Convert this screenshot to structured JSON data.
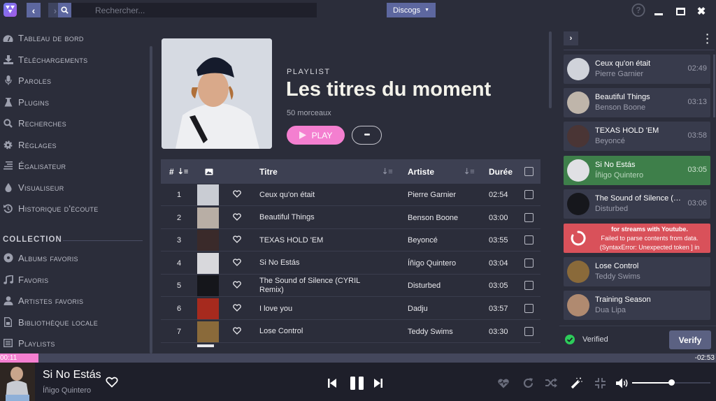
{
  "topbar": {
    "search_placeholder": "Rechercher...",
    "search_value": "",
    "source_selected": "Discogs",
    "back_label": "back",
    "forward_label": "forward"
  },
  "sidebar": {
    "items": [
      {
        "label": "Tableau de bord",
        "icon": "dashboard-icon"
      },
      {
        "label": "Téléchargements",
        "icon": "download-icon"
      },
      {
        "label": "Paroles",
        "icon": "microphone-icon"
      },
      {
        "label": "Plugins",
        "icon": "flask-icon"
      },
      {
        "label": "Recherches",
        "icon": "search-icon"
      },
      {
        "label": "Réglages",
        "icon": "gear-icon"
      },
      {
        "label": "Égalisateur",
        "icon": "equalizer-icon"
      },
      {
        "label": "Visualiseur",
        "icon": "droplet-icon"
      },
      {
        "label": "Historique d'écoute",
        "icon": "history-icon"
      }
    ],
    "collection_title": "COLLECTION",
    "collection_items": [
      {
        "label": "Albums favoris",
        "icon": "disc-icon"
      },
      {
        "label": "Favoris",
        "icon": "music-note-icon"
      },
      {
        "label": "Artistes favoris",
        "icon": "user-icon"
      },
      {
        "label": "Bibliothèque locale",
        "icon": "local-file-icon"
      },
      {
        "label": "Playlists",
        "icon": "list-icon"
      }
    ]
  },
  "playlist": {
    "type_label": "PLAYLIST",
    "title": "Les titres du moment",
    "count": "50 morceaux",
    "play_label": "PLAY",
    "more_label": "•••"
  },
  "table": {
    "headers": {
      "number": "#",
      "title": "Titre",
      "artist": "Artiste",
      "duration": "Durée"
    },
    "rows": [
      {
        "n": "1",
        "title": "Ceux qu'on était",
        "artist": "Pierre Garnier",
        "duration": "02:54",
        "thumb": "#c9ccd3"
      },
      {
        "n": "2",
        "title": "Beautiful Things",
        "artist": "Benson Boone",
        "duration": "03:00",
        "thumb": "#b8aea5"
      },
      {
        "n": "3",
        "title": "TEXAS HOLD 'EM",
        "artist": "Beyoncé",
        "duration": "03:55",
        "thumb": "#3a2a2a"
      },
      {
        "n": "4",
        "title": "Si No Estás",
        "artist": "Íñigo Quintero",
        "duration": "03:04",
        "thumb": "#d8d8dc"
      },
      {
        "n": "5",
        "title": "The Sound of Silence (CYRIL Remix)",
        "artist": "Disturbed",
        "duration": "03:05",
        "thumb": "#15161b"
      },
      {
        "n": "6",
        "title": "I love you",
        "artist": "Dadju",
        "duration": "03:57",
        "thumb": "#a62a1e"
      },
      {
        "n": "7",
        "title": "Lose Control",
        "artist": "Teddy Swims",
        "duration": "03:30",
        "thumb": "#8a6a3a"
      }
    ]
  },
  "queue": {
    "items": [
      {
        "title": "Ceux qu'on était",
        "artist": "Pierre Garnier",
        "duration": "02:49",
        "active": false,
        "thumb": "#d0d3da"
      },
      {
        "title": "Beautiful Things",
        "artist": "Benson Boone",
        "duration": "03:13",
        "active": false,
        "thumb": "#bfb5aa"
      },
      {
        "title": "TEXAS HOLD 'EM",
        "artist": "Beyoncé",
        "duration": "03:58",
        "active": false,
        "thumb": "#4a3535"
      },
      {
        "title": "Si No Estás",
        "artist": "Íñigo Quintero",
        "duration": "03:05",
        "active": true,
        "thumb": "#e0e0e4"
      },
      {
        "title": "The Sound of Silence (CYRIL Remix)",
        "artist": "Disturbed",
        "duration": "03:06",
        "active": false,
        "thumb": "#16171c"
      },
      {
        "title": "Lose Control",
        "artist": "Teddy Swims",
        "duration": "",
        "active": false,
        "thumb": "#8a6a3a"
      },
      {
        "title": "Training Season",
        "artist": "Dua Lipa",
        "duration": "",
        "active": false,
        "thumb": "#b08a70"
      }
    ],
    "error": {
      "line1": "for streams with Youtube.",
      "line2": "Failed to parse contents from data.",
      "line3": "(SyntaxError: Unexpected token ] in"
    },
    "verified_label": "Verified",
    "verify_button": "Verify"
  },
  "player": {
    "title": "Si No Estás",
    "artist": "Íñigo Quintero",
    "elapsed": "00:11",
    "remaining": "-02:53",
    "progress_fraction": 0.054,
    "volume_fraction": 0.5,
    "colors": {
      "accent": "#f47fd0",
      "active_queue": "#3e7f4a",
      "error": "#d9515a"
    }
  }
}
